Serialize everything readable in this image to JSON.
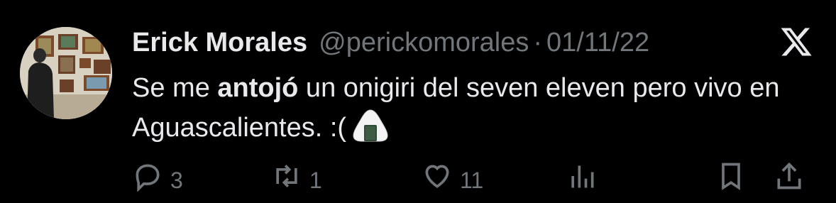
{
  "author": {
    "name": "Erick Morales",
    "handle": "@perickomorales",
    "separator": "·",
    "date": "01/11/22"
  },
  "tweet": {
    "text_part1": "Se me ",
    "text_bold": "antojó",
    "text_part2": " un onigiri del seven eleven pero vivo en Aguascalientes. :(",
    "emoji": "onigiri-emoji"
  },
  "actions": {
    "replies": "3",
    "retweets": "1",
    "likes": "11"
  },
  "colors": {
    "background": "#000000",
    "text": "#e7e9ea",
    "muted": "#71767b"
  },
  "icons": [
    "x-logo-icon",
    "reply-icon",
    "retweet-icon",
    "like-icon",
    "views-icon",
    "bookmark-icon",
    "share-icon"
  ]
}
